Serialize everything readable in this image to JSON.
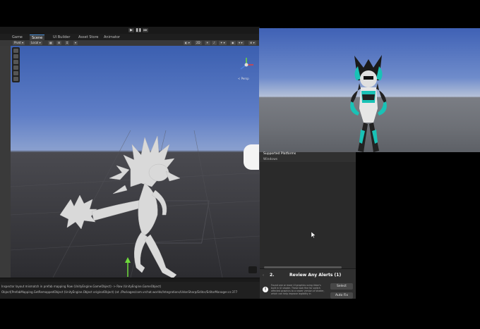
{
  "editor": {
    "tabs": [
      "Game",
      "Scene",
      "UI Builder",
      "Asset Store",
      "Animator"
    ],
    "active_tab": "Scene",
    "scene_toolbar": {
      "pivot": "Pivot",
      "space": "Local",
      "view_2d": "2D"
    },
    "persp_label": "< Persp",
    "console_lines": [
      "Inspector layout mismatch in prefab mapping Row (UnityEngine.GameObject) -> Row (UnityEngine.GameObject)",
      "Object[PrefabMapping.GetRemappedObject (UnityEngine.Object originalObject) (at ./Packages/com.vrchat.worlds/Integrations/UdonSharp/Editor/EditorManager.cs:377"
    ]
  },
  "panel": {
    "header_title": "Supported Platforms",
    "header_value": "Windows",
    "step_number": "2.",
    "step_title": "Review Any Alerts (1)",
    "alert_text": "Found one or more UI graphics using Udon's built in UI shader. These look fine for switch affected graphics to a newer version of shader, which can help improve legibility in",
    "select_button": "Select",
    "auto_fix_button": "Auto Fix"
  },
  "colors": {
    "editor_bg": "#282828",
    "accent": "#4a90d9",
    "avatar_teal": "#19c2b6"
  }
}
